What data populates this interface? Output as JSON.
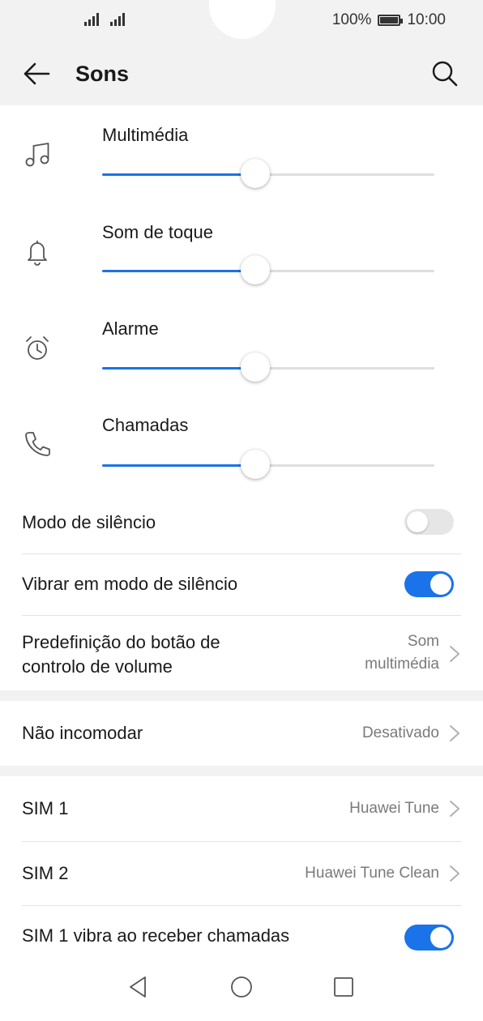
{
  "status_bar": {
    "battery_text": "100%",
    "time": "10:00"
  },
  "header": {
    "title": "Sons"
  },
  "volumes": [
    {
      "label": "Multimédia",
      "icon": "music-note-icon",
      "level": 0.46
    },
    {
      "label": "Som de toque",
      "icon": "bell-icon",
      "level": 0.46
    },
    {
      "label": "Alarme",
      "icon": "alarm-clock-icon",
      "level": 0.46
    },
    {
      "label": "Chamadas",
      "icon": "phone-icon",
      "level": 0.46
    }
  ],
  "settings": {
    "silent_mode": {
      "label": "Modo de silêncio",
      "enabled": false
    },
    "vibrate_silent": {
      "label": "Vibrar em modo de silêncio",
      "enabled": true
    },
    "volume_button": {
      "label_line1": "Predefinição do botão de",
      "label_line2": "controlo de volume",
      "value_line1": "Som",
      "value_line2": "multimédia"
    },
    "do_not_disturb": {
      "label": "Não incomodar",
      "value": "Desativado"
    },
    "sim1": {
      "label": "SIM 1",
      "value": "Huawei Tune"
    },
    "sim2": {
      "label": "SIM 2",
      "value": "Huawei Tune Clean"
    },
    "sim1_vibrate": {
      "label": "SIM 1 vibra ao receber chamadas",
      "enabled": true
    }
  },
  "colors": {
    "accent": "#1a73e8",
    "section_bg": "#f2f2f2",
    "secondary_text": "#7a7a7a"
  }
}
